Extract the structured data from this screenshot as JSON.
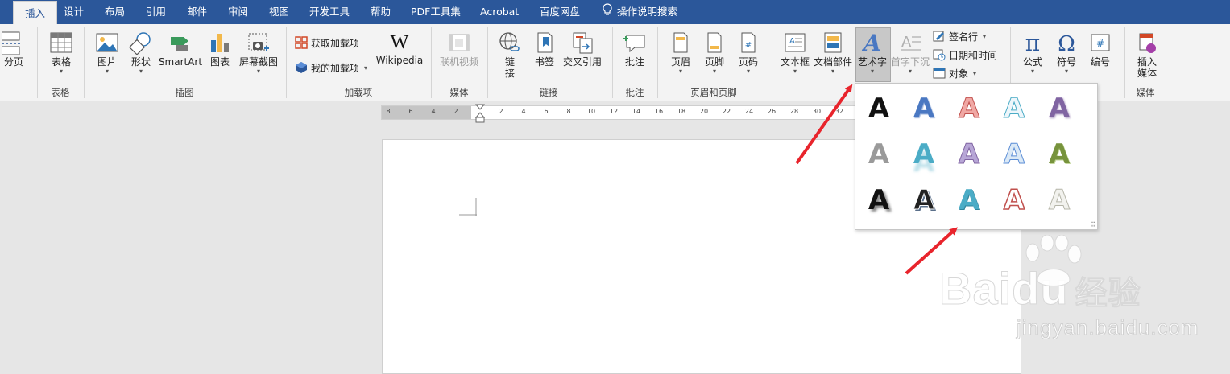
{
  "tabs": [
    "插入",
    "设计",
    "布局",
    "引用",
    "邮件",
    "审阅",
    "视图",
    "开发工具",
    "帮助",
    "PDF工具集",
    "Acrobat",
    "百度网盘",
    "操作说明搜索"
  ],
  "ribbon": {
    "page_break": "分页",
    "table": "表格",
    "picture": "图片",
    "shapes": "形状",
    "smartart": "SmartArt",
    "chart": "图表",
    "screenshot": "屏幕截图",
    "get_addins": "获取加载项",
    "my_addins": "我的加载项",
    "wikipedia": "Wikipedia",
    "online_video": "联机视频",
    "link_top": "链",
    "link_bottom": "接",
    "bookmark": "书签",
    "cross_ref": "交叉引用",
    "comment": "批注",
    "header": "页眉",
    "footer": "页脚",
    "page_number": "页码",
    "textbox": "文本框",
    "quick_parts": "文档部件",
    "wordart": "艺术字",
    "drop_cap": "首字下沉",
    "signature_line": "签名行",
    "date_time": "日期和时间",
    "object": "对象",
    "equation": "公式",
    "symbol": "符号",
    "number": "编号",
    "insert_media_1": "插入",
    "insert_media_2": "媒体"
  },
  "groups": {
    "tables": "表格",
    "illustrations": "插图",
    "addins": "加载项",
    "media": "媒体",
    "links": "链接",
    "comments": "批注",
    "header_footer": "页眉和页脚",
    "media2": "媒体"
  },
  "ruler_labels": [
    "8",
    "6",
    "4",
    "2",
    "2",
    "4",
    "6",
    "8",
    "10",
    "12",
    "14",
    "16",
    "18",
    "20",
    "22",
    "24",
    "26",
    "28",
    "30",
    "32"
  ],
  "wordart_styles": [
    {
      "name": "填充: 黑色",
      "letter": "A",
      "color": "#111111"
    },
    {
      "name": "填充: 蓝色",
      "letter": "A",
      "color": "#4a78c2"
    },
    {
      "name": "填充: 红色轮廓",
      "letter": "A",
      "color": "#f0a8a4"
    },
    {
      "name": "填充: 浅蓝轮廓",
      "letter": "A",
      "color": "#e6f2f8"
    },
    {
      "name": "填充: 紫色",
      "letter": "A",
      "color": "#8064a2"
    },
    {
      "name": "填充: 灰色",
      "letter": "A",
      "color": "#9a9a9a"
    },
    {
      "name": "填充: 青色映像",
      "letter": "A",
      "color": "#4bacc6"
    },
    {
      "name": "填充: 淡紫",
      "letter": "A",
      "color": "#b7a6d6"
    },
    {
      "name": "填充: 浅蓝",
      "letter": "A",
      "color": "#dbe9f6"
    },
    {
      "name": "渐变: 绿色",
      "letter": "A",
      "color": "#77933c"
    },
    {
      "name": "填充: 黑色阴影",
      "letter": "A",
      "color": "#111111"
    },
    {
      "name": "填充: 黑色白边",
      "letter": "A",
      "color": "#222222"
    },
    {
      "name": "填充: 青色",
      "letter": "A",
      "color": "#4bacc6"
    },
    {
      "name": "填充: 红色轮廓白",
      "letter": "A",
      "color": "#ffffff"
    },
    {
      "name": "填充: 灰白",
      "letter": "A",
      "color": "#f2f2ee"
    }
  ],
  "watermark": {
    "brand": "Baidu",
    "brand_cn": "经验",
    "url": "jingyan.baidu.com"
  },
  "colors": {
    "accent": "#2b579a",
    "arrow": "#e8242c"
  }
}
